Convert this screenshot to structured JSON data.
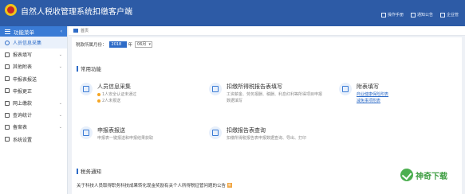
{
  "app": {
    "title": "自然人税收管理系统扣缴客户端"
  },
  "header": {
    "items": [
      {
        "label": "操作手册",
        "icon": "manual-icon"
      },
      {
        "label": "通知公告",
        "icon": "notice-icon"
      },
      {
        "label": "企业管",
        "icon": "company-icon"
      }
    ]
  },
  "sidebar": {
    "title": "功能菜单",
    "items": [
      {
        "label": "人员信息采集",
        "icon": "person-icon",
        "active": true,
        "expandable": false
      },
      {
        "label": "报表填写",
        "icon": "form-icon",
        "expandable": true
      },
      {
        "label": "其他附表",
        "icon": "attachment-icon",
        "expandable": true
      },
      {
        "label": "申报表报送",
        "icon": "submit-icon",
        "expandable": false
      },
      {
        "label": "申报更正",
        "icon": "correct-icon",
        "expandable": false
      },
      {
        "label": "网上缴款",
        "icon": "payment-icon",
        "expandable": true
      },
      {
        "label": "查询统计",
        "icon": "stats-icon",
        "expandable": true
      },
      {
        "label": "备案表",
        "icon": "record-icon",
        "expandable": true
      },
      {
        "label": "系统设置",
        "icon": "settings-icon",
        "expandable": false
      }
    ]
  },
  "breadcrumb": {
    "label": "首页"
  },
  "period": {
    "label": "税款所属月份：",
    "year": "2018",
    "year_suffix": "年",
    "month": "06月"
  },
  "sections": {
    "common": "常用功能",
    "tax_notice": "税务通知"
  },
  "functions": {
    "personnel": {
      "title": "人员信息采集",
      "line1": "1人安全认证未通过",
      "line2": "2人未报送"
    },
    "withholding": {
      "title": "扣缴所得税报告表填写",
      "line1": "工资薪金、劳务报酬、稿酬、利息红利等所得项目申报",
      "line2": "数据填写"
    },
    "attached": {
      "title": "附表填写",
      "link1": "商业健康保险附表",
      "link2": "减免事项附表"
    },
    "submit": {
      "title": "申报表报送",
      "line1": "申报表一键报送和申报结果获取"
    },
    "query": {
      "title": "扣缴报告表查询",
      "line1": "扣缴所得税报告表申报数据查询、导出、打印"
    }
  },
  "notice": {
    "text": "关于科技人员取得职务科技成果转化现金奖励有关个人所得税征管问题的公告",
    "badge": "新"
  },
  "watermark": {
    "text": "神奇下载"
  },
  "colors": {
    "header": "#2d5ba6",
    "accent": "#3a7bd5",
    "active_bg": "#eaf1fb"
  }
}
